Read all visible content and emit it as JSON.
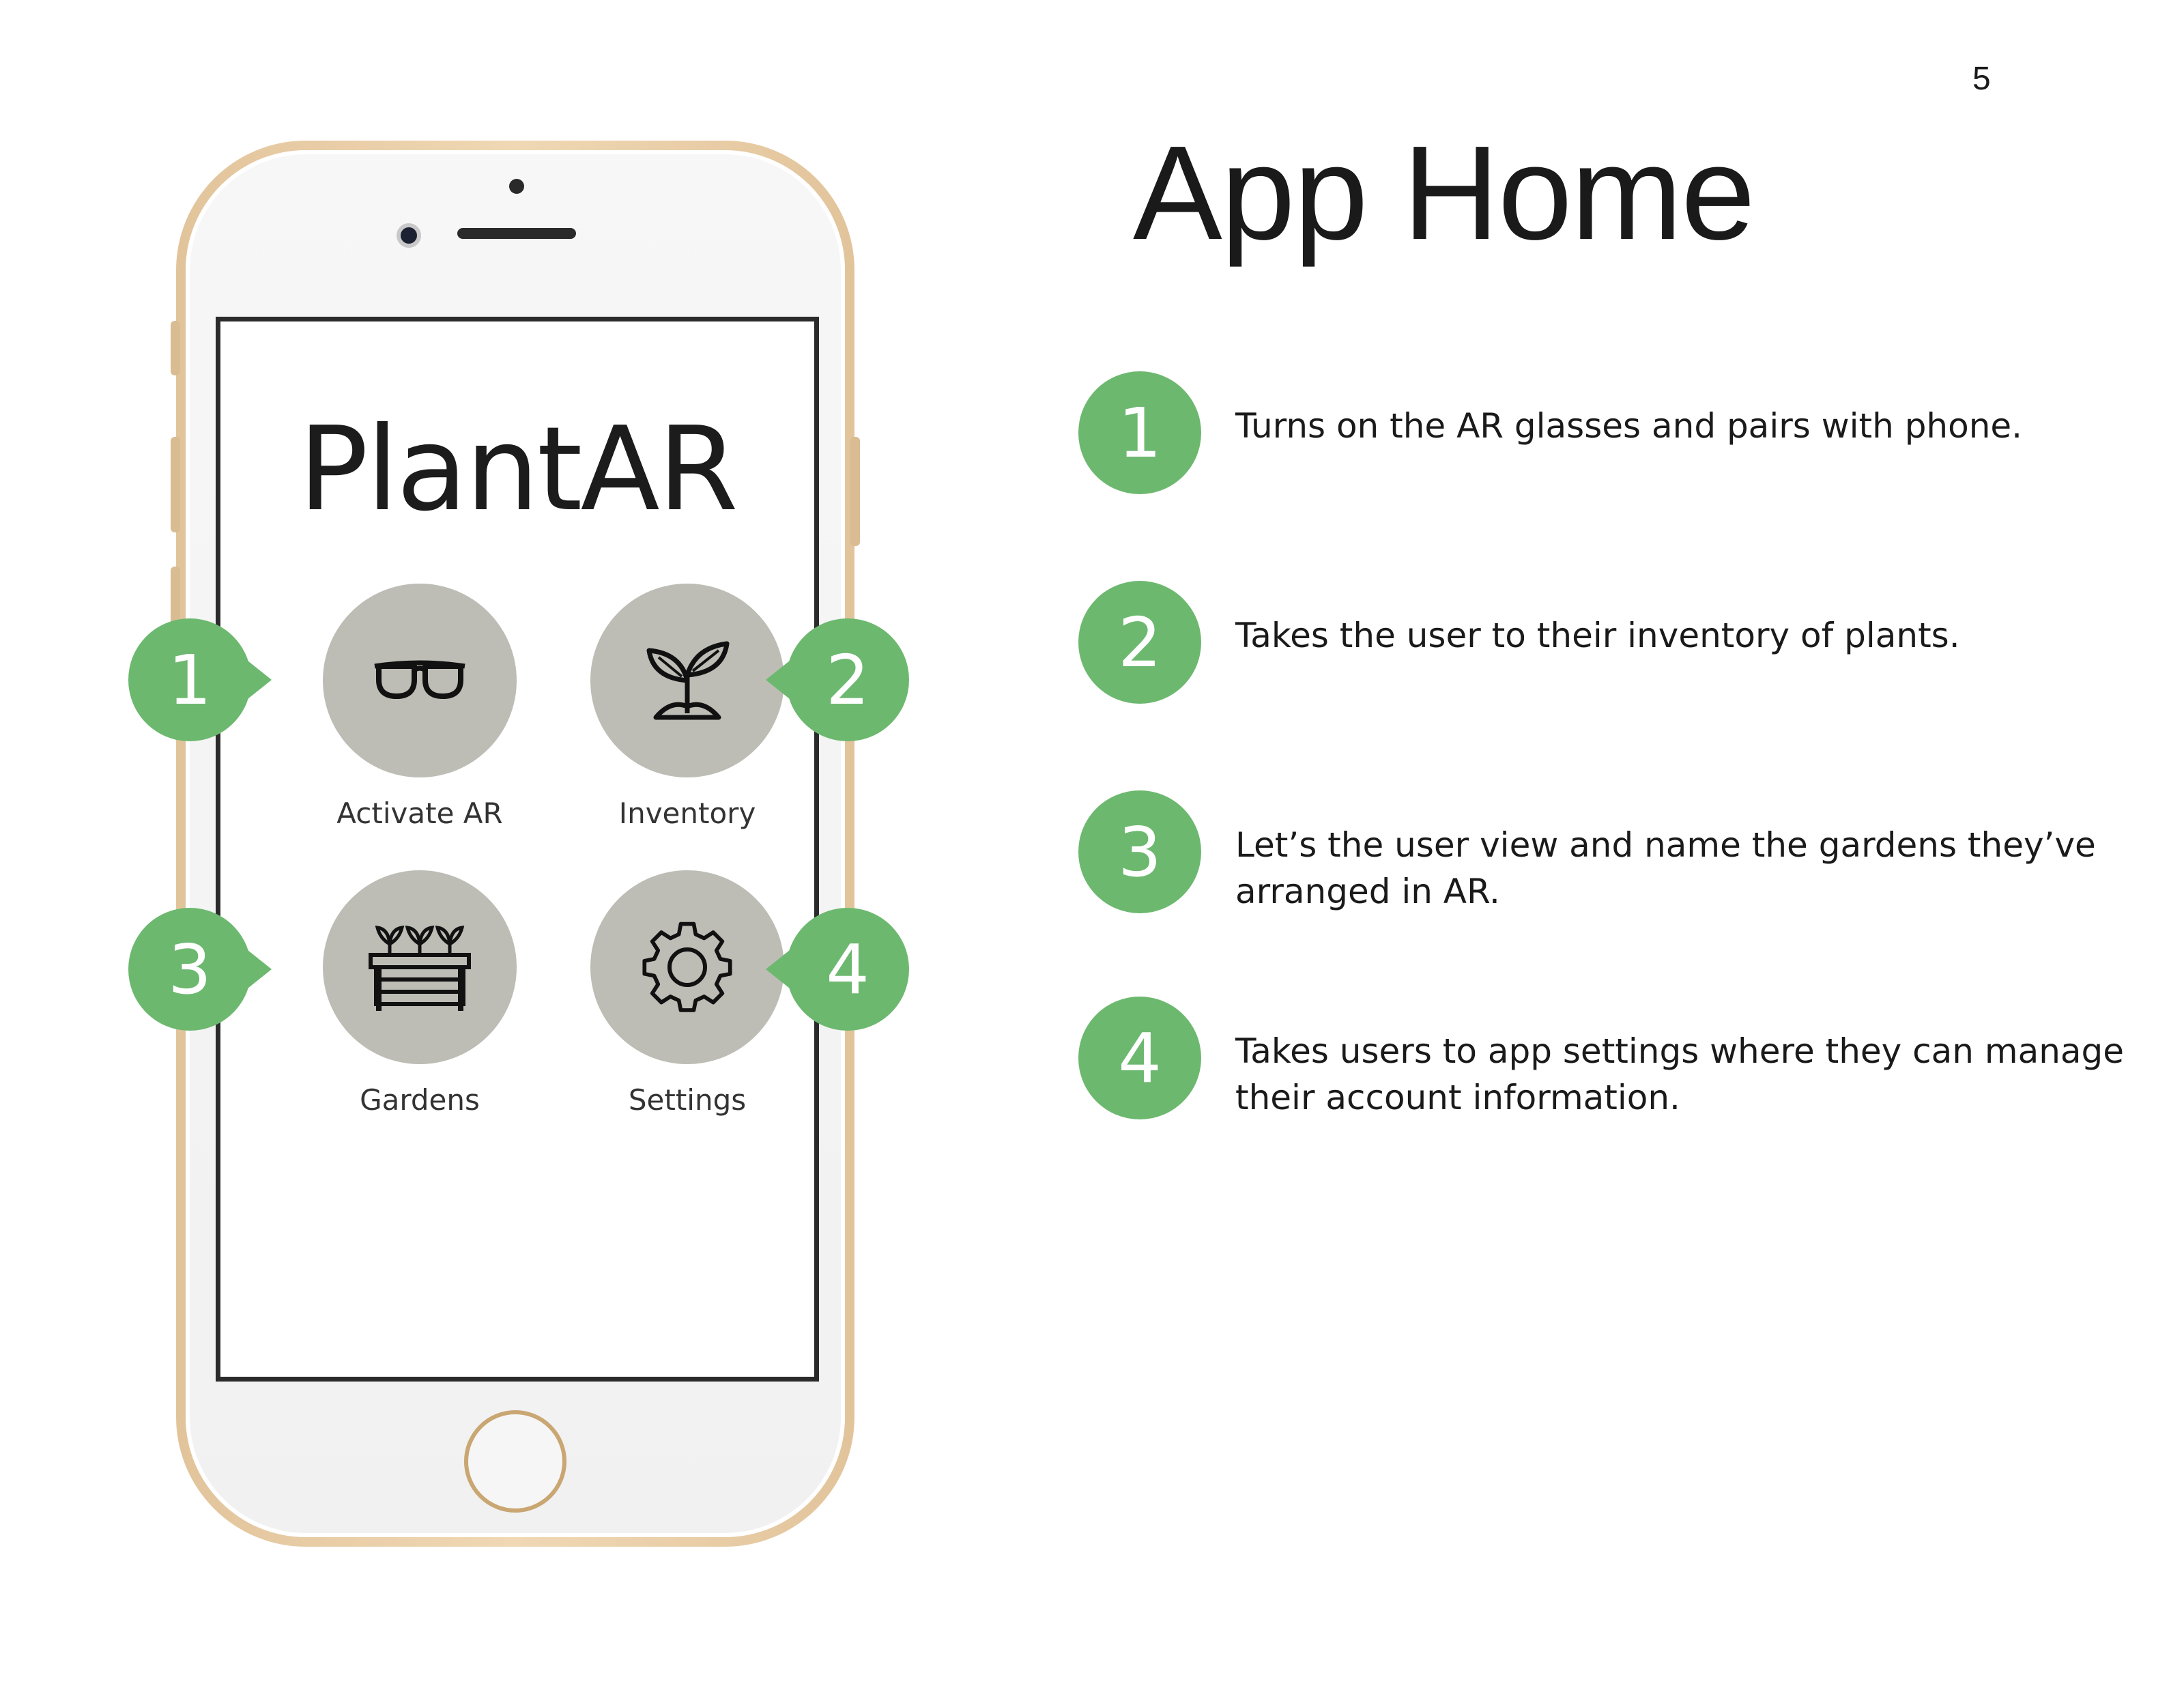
{
  "page": {
    "number": "5",
    "title": "App Home"
  },
  "app": {
    "name": "PlantAR",
    "tiles": [
      {
        "label": "Activate AR",
        "icon": "glasses-icon"
      },
      {
        "label": "Inventory",
        "icon": "sprout-icon"
      },
      {
        "label": "Gardens",
        "icon": "garden-box-icon"
      },
      {
        "label": "Settings",
        "icon": "gear-icon"
      }
    ]
  },
  "markers": [
    "1",
    "2",
    "3",
    "4"
  ],
  "legend": [
    {
      "number": "1",
      "text": "Turns on the AR glasses and pairs with phone."
    },
    {
      "number": "2",
      "text": "Takes the user to their inventory of plants."
    },
    {
      "number": "3",
      "text": "Let’s the user view and name the gardens they’ve arranged in AR."
    },
    {
      "number": "4",
      "text": "Takes users to app settings where they can manage their account information."
    }
  ],
  "colors": {
    "accent_green": "#6cb86f",
    "tile_gray": "#bdbdb6",
    "phone_gold": "#e2c49b"
  }
}
